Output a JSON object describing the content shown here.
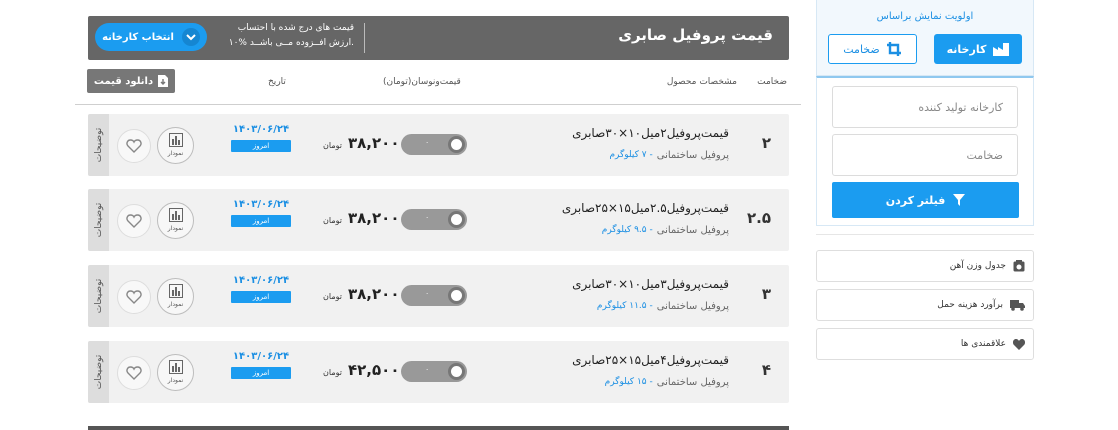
{
  "sidebar": {
    "priority_label": "اولویت نمایش براساس",
    "factory_button": "کارخانه",
    "thickness_button": "ضخامت",
    "maker_placeholder": "کارخانه تولید کننده",
    "thickness_placeholder": "ضخامت",
    "filter_button": "فیلتر کردن",
    "links": [
      {
        "label": "جدول وزن آهن",
        "icon": "table-icon"
      },
      {
        "label": "برآورد هزینه حمل",
        "icon": "truck-icon"
      },
      {
        "label": "علاقمندی ها",
        "icon": "heart-icon"
      }
    ]
  },
  "header": {
    "title": "قیمت پروفیل صابری",
    "note_line1": "قیمت های درج شده با احتساب",
    "note_line2": "۱۰% ارزش افــزوده مــی باشــد.",
    "select_factory": "انتخاب کارخانه"
  },
  "columns": {
    "thickness": "ضخامت",
    "specs": "مشخصات محصول",
    "price_change": "قیمت‌و‌نوسان(تومان)",
    "date": "تاریخ",
    "download": "دانلود قیمت"
  },
  "rows": [
    {
      "thickness": "۲",
      "title": "قیمت‌پروفیل۲میل۱۰×۳۰صابری",
      "category": "پروفیل ساختمانی",
      "weight": "- ۷ کیلوگرم",
      "toggle_value": "۰",
      "price": "۳۸,۲۰۰",
      "unit": "تومان",
      "date": "۱۴۰۳/۰۶/۲۴",
      "today": "امروز",
      "chart_label": "نمودار",
      "desc_label": "توضیحات"
    },
    {
      "thickness": "۲.۵",
      "title": "قیمت‌پروفیل۲.۵میل۱۵×۲۵صابری",
      "category": "پروفیل ساختمانی",
      "weight": "- ۹.۵ کیلوگرم",
      "toggle_value": "۰",
      "price": "۳۸,۲۰۰",
      "unit": "تومان",
      "date": "۱۴۰۳/۰۶/۲۴",
      "today": "امروز",
      "chart_label": "نمودار",
      "desc_label": "توضیحات"
    },
    {
      "thickness": "۳",
      "title": "قیمت‌پروفیل۳میل۱۰×۳۰صابری",
      "category": "پروفیل ساختمانی",
      "weight": "- ۱۱.۵ کیلوگرم",
      "toggle_value": "۰",
      "price": "۳۸,۲۰۰",
      "unit": "تومان",
      "date": "۱۴۰۳/۰۶/۲۴",
      "today": "امروز",
      "chart_label": "نمودار",
      "desc_label": "توضیحات"
    },
    {
      "thickness": "۴",
      "title": "قیمت‌پروفیل۴میل۱۵×۲۵صابری",
      "category": "پروفیل ساختمانی",
      "weight": "- ۱۵ کیلوگرم",
      "toggle_value": "۰",
      "price": "۴۲,۵۰۰",
      "unit": "تومان",
      "date": "۱۴۰۳/۰۶/۲۴",
      "today": "امروز",
      "chart_label": "نمودار",
      "desc_label": "توضیحات"
    }
  ],
  "colors": {
    "accent": "#1b9cf0",
    "header_bg": "#666666",
    "row_bg": "#f1f1f1"
  }
}
